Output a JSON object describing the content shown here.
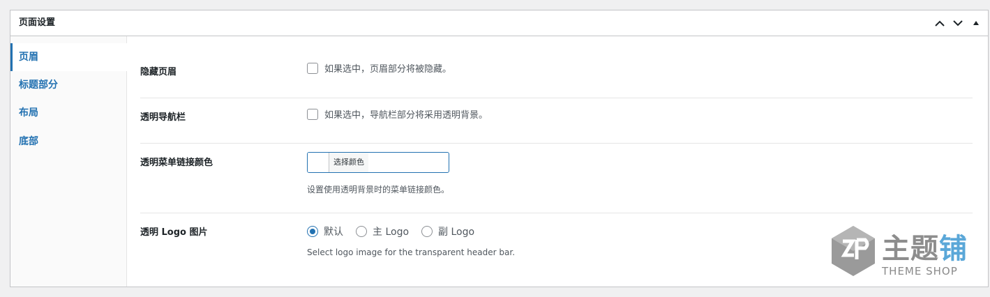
{
  "panel": {
    "title": "页面设置"
  },
  "sidebar": {
    "items": [
      {
        "label": "页眉",
        "active": true
      },
      {
        "label": "标题部分",
        "active": false
      },
      {
        "label": "布局",
        "active": false
      },
      {
        "label": "底部",
        "active": false
      }
    ]
  },
  "settings": {
    "hide_header": {
      "label": "隐藏页眉",
      "checkbox_text": "如果选中，页眉部分将被隐藏。",
      "checked": false
    },
    "transparent_nav": {
      "label": "透明导航栏",
      "checkbox_text": "如果选中，导航栏部分将采用透明背景。",
      "checked": false
    },
    "transparent_menu_color": {
      "label": "透明菜单链接颜色",
      "button_text": "选择颜色",
      "description": "设置使用透明背景时的菜单链接颜色。"
    },
    "transparent_logo": {
      "label": "透明 Logo 图片",
      "options": [
        "默认",
        "主 Logo",
        "副 Logo"
      ],
      "selected": "默认",
      "description": "Select logo image for the transparent header bar."
    }
  },
  "watermark": {
    "text_part1": "主题",
    "text_part2": "铺",
    "subtext": "THEME SHOP"
  },
  "colors": {
    "accent": "#2271b1",
    "text": "#1d2327",
    "muted": "#50575e",
    "border": "#c3c4c7"
  }
}
